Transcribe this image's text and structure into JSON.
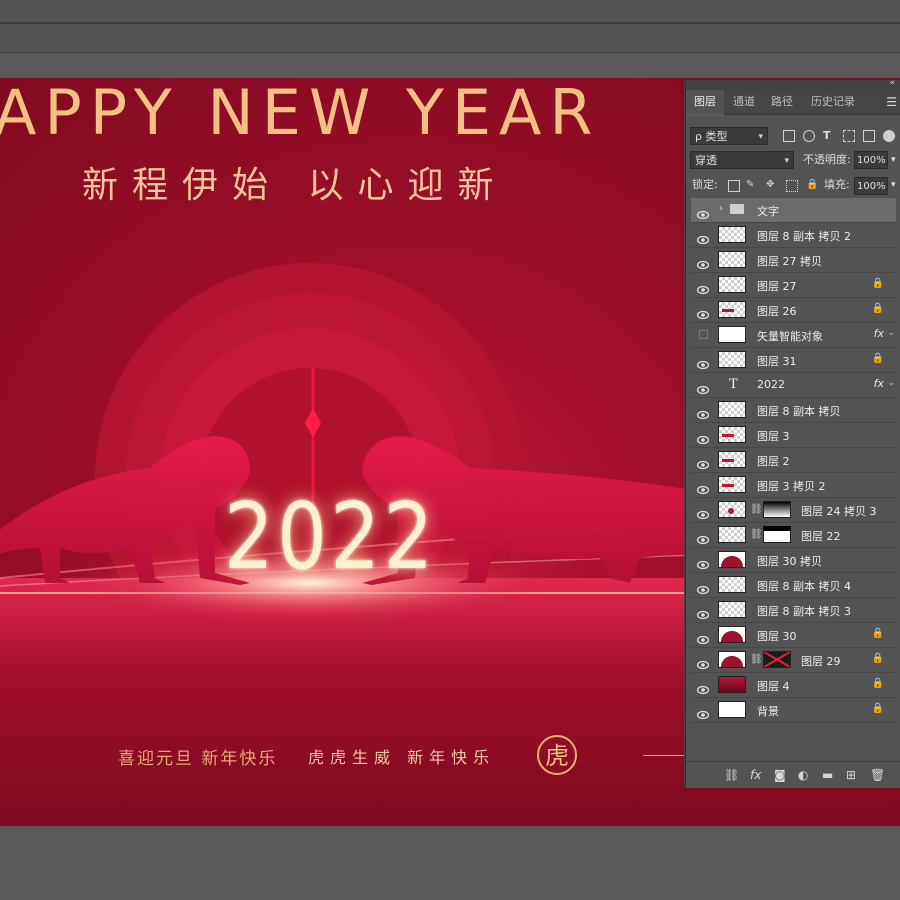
{
  "canvas": {
    "headline": "APPY NEW YEAR",
    "subhead": "新程伊始  以心迎新",
    "year": "2022",
    "footer_left": "喜迎元旦 新年快乐",
    "footer_mid": "虎虎生威 新年快乐",
    "seal": "虎"
  },
  "panel": {
    "tabs": [
      "图层",
      "通道",
      "路径",
      "历史记录"
    ],
    "active_tab": "图层",
    "filter_label": "ρ 类型",
    "blend_mode": "穿透",
    "opacity_label": "不透明度:",
    "opacity_value": "100%",
    "lock_label": "锁定:",
    "fill_label": "填充:",
    "fill_value": "100%",
    "layers": [
      {
        "name": "文字",
        "type": "group",
        "visible": true,
        "selected": true
      },
      {
        "name": "图层 8 副本 拷贝 2",
        "visible": true
      },
      {
        "name": "图层 27 拷贝",
        "visible": true
      },
      {
        "name": "图层 27",
        "visible": true,
        "locked": true
      },
      {
        "name": "图层 26",
        "visible": true,
        "locked": true
      },
      {
        "name": "矢量智能对象",
        "visible": false,
        "fx": "fx"
      },
      {
        "name": "图层 31",
        "visible": true,
        "locked": true
      },
      {
        "name": "2022",
        "type": "text",
        "visible": true,
        "fx": "fx"
      },
      {
        "name": "图层 8 副本 拷贝",
        "visible": true
      },
      {
        "name": "图层 3",
        "visible": true
      },
      {
        "name": "图层 2",
        "visible": true
      },
      {
        "name": "图层 3 拷贝 2",
        "visible": true
      },
      {
        "name": "图层 24 拷贝 3",
        "visible": true,
        "mask": true
      },
      {
        "name": "图层 22",
        "visible": true,
        "mask": true
      },
      {
        "name": "图层 30 拷贝",
        "visible": true
      },
      {
        "name": "图层 8 副本 拷贝 4",
        "visible": true
      },
      {
        "name": "图层 8 副本 拷贝 3",
        "visible": true
      },
      {
        "name": "图层 30",
        "visible": true,
        "locked": true
      },
      {
        "name": "图层 29",
        "visible": true,
        "locked": true,
        "mask": true
      },
      {
        "name": "图层 4",
        "visible": true,
        "locked": true
      },
      {
        "name": "背景",
        "visible": true,
        "locked": true
      }
    ],
    "bottom_icons": [
      "link-icon",
      "fx-icon",
      "mask-icon",
      "adjustment-icon",
      "folder-icon",
      "new-layer-icon",
      "trash-icon"
    ],
    "fx_label": "fx",
    "lock_glyph": "🔒",
    "t_glyph": "T"
  }
}
